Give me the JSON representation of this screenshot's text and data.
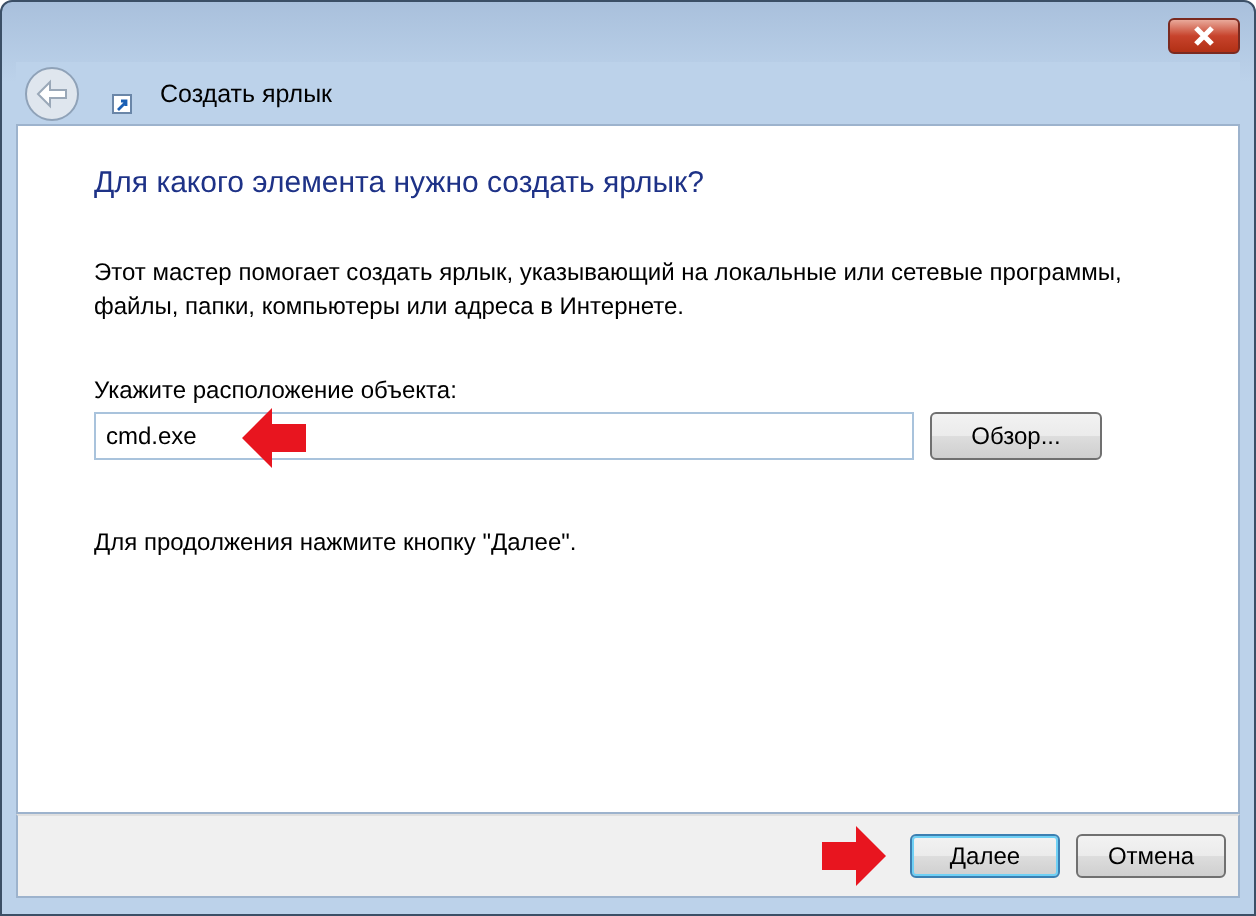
{
  "window": {
    "title": "Создать ярлык"
  },
  "heading": "Для какого элемента нужно создать ярлык?",
  "description": "Этот мастер помогает создать ярлык, указывающий на локальные или сетевые программы, файлы, папки, компьютеры или адреса в Интернете.",
  "location": {
    "label": "Укажите расположение объекта:",
    "value": "cmd.exe",
    "browse_button": "Обзор..."
  },
  "hint": "Для продолжения нажмите кнопку \"Далее\".",
  "buttons": [
    {
      "label": "Далее",
      "selected": true
    },
    {
      "label": "Отмена",
      "selected": false
    }
  ]
}
